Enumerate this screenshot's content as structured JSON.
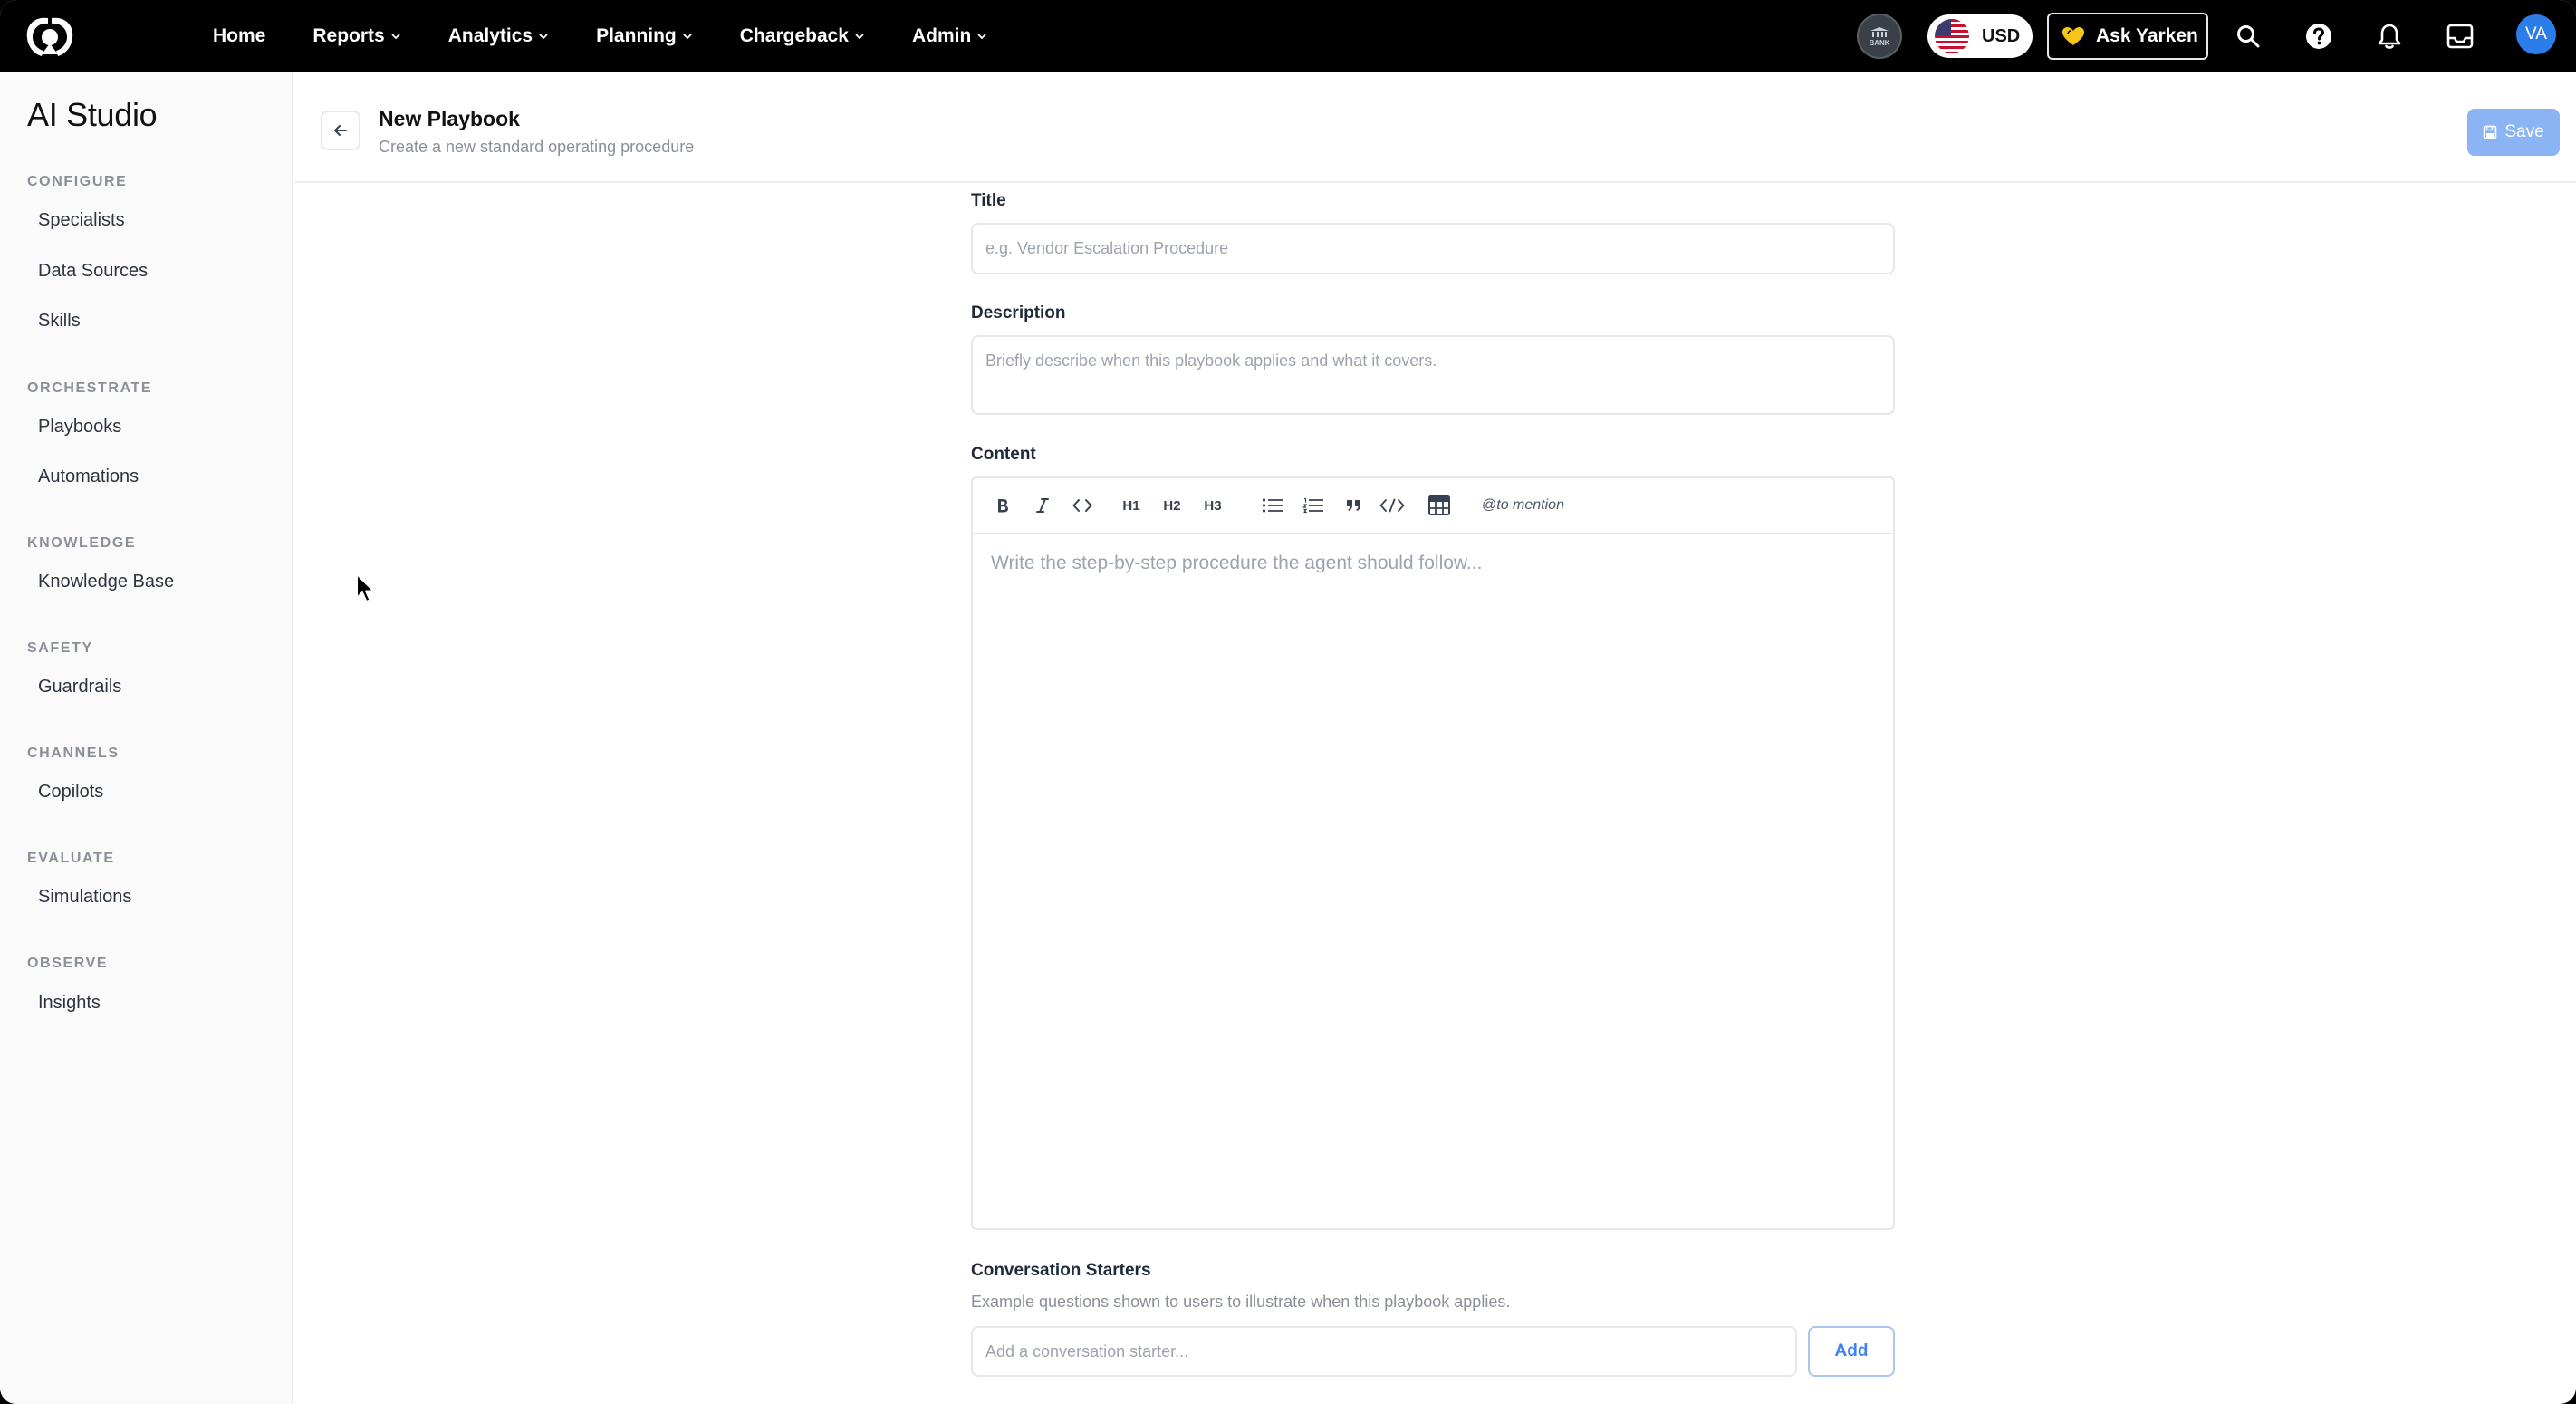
{
  "topnav": {
    "items": [
      {
        "label": "Home",
        "has_dropdown": false
      },
      {
        "label": "Reports",
        "has_dropdown": true
      },
      {
        "label": "Analytics",
        "has_dropdown": true
      },
      {
        "label": "Planning",
        "has_dropdown": true
      },
      {
        "label": "Chargeback",
        "has_dropdown": true
      },
      {
        "label": "Admin",
        "has_dropdown": true
      }
    ],
    "bank_badge": "BANK",
    "currency": "USD",
    "ask_label": "Ask Yarken",
    "avatar_initials": "VA",
    "icons": [
      "search-icon",
      "help-icon",
      "bell-icon",
      "inbox-icon"
    ]
  },
  "sidebar": {
    "title": "AI Studio",
    "sections": [
      {
        "label": "CONFIGURE",
        "items": [
          "Specialists",
          "Data Sources",
          "Skills"
        ]
      },
      {
        "label": "ORCHESTRATE",
        "items": [
          "Playbooks",
          "Automations"
        ]
      },
      {
        "label": "KNOWLEDGE",
        "items": [
          "Knowledge Base"
        ]
      },
      {
        "label": "SAFETY",
        "items": [
          "Guardrails"
        ]
      },
      {
        "label": "CHANNELS",
        "items": [
          "Copilots"
        ]
      },
      {
        "label": "EVALUATE",
        "items": [
          "Simulations"
        ]
      },
      {
        "label": "OBSERVE",
        "items": [
          "Insights"
        ]
      }
    ]
  },
  "header": {
    "title": "New Playbook",
    "subtitle": "Create a new standard operating procedure",
    "save_label": "Save"
  },
  "form": {
    "title_label": "Title",
    "title_value": "",
    "title_placeholder": "e.g. Vendor Escalation Procedure",
    "description_label": "Description",
    "description_value": "",
    "description_placeholder": "Briefly describe when this playbook applies and what it covers.",
    "content_label": "Content",
    "content_placeholder": "Write the step-by-step procedure the agent should follow...",
    "toolbar": {
      "h1": "H1",
      "h2": "H2",
      "h3": "H3",
      "mention_at": "@",
      "mention_text": "to mention"
    },
    "starters_label": "Conversation Starters",
    "starters_helper": "Example questions shown to users to illustrate when this playbook applies.",
    "starter_value": "",
    "starter_placeholder": "Add a conversation starter...",
    "add_label": "Add"
  },
  "colors": {
    "nav_bg": "#000000",
    "accent": "#3b82f6",
    "save_disabled": "#8ab4f3",
    "avatar": "#2b7de9"
  }
}
